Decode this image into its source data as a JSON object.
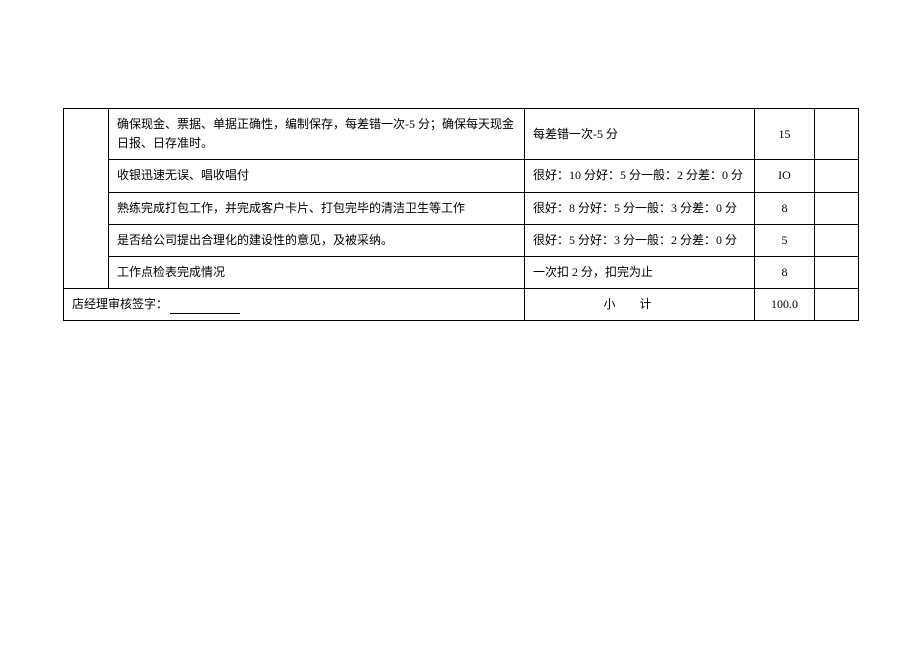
{
  "rows": [
    {
      "desc": "确保现金、票据、单据正确性，编制保存，每差错一次-5 分；确保每天现金日报、日存准时。",
      "criteria": "每差错一次-5 分",
      "score": "15"
    },
    {
      "desc": "收银迅速无误、唱收唱付",
      "criteria": "很好：10 分好：5 分一般：2 分差：0 分",
      "score": "IO"
    },
    {
      "desc": "熟练完成打包工作，并完成客户卡片、打包完毕的清洁卫生等工作",
      "criteria": "很好：8 分好：5 分一般：3 分差：0 分",
      "score": "8"
    },
    {
      "desc": "是否给公司提出合理化的建设性的意见，及被采纳。",
      "criteria": "很好：5 分好：3 分一般：2 分差：0 分",
      "score": "5"
    },
    {
      "desc": "工作点检表完成情况",
      "criteria": "一次扣 2 分，扣完为止",
      "score": "8"
    }
  ],
  "footer": {
    "signature_label": "店经理审核签字：",
    "subtotal_label": "小计",
    "subtotal_value": "100.0"
  }
}
